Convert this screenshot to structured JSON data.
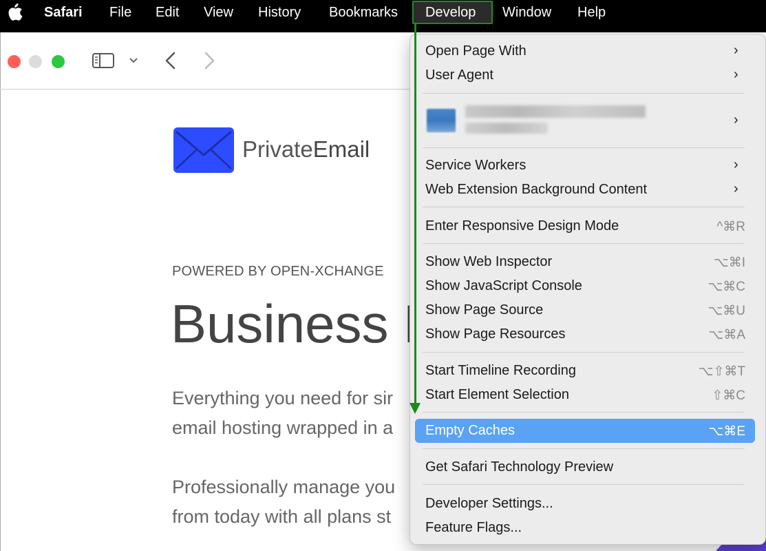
{
  "menubar": {
    "app": "Safari",
    "items": [
      "File",
      "Edit",
      "View",
      "History",
      "Bookmarks",
      "Develop",
      "Window",
      "Help"
    ]
  },
  "page": {
    "brand_light": "Private",
    "brand_bold": "Email",
    "powered_by": "POWERED BY OPEN-XCHANGE",
    "headline": "Business E",
    "para1_line1": "Everything you need for sir",
    "para1_line2": "email hosting wrapped in a",
    "para2_line1": "Professionally manage you",
    "para2_line2": "from today with all plans st"
  },
  "develop_menu": {
    "open_page_with": "Open Page With",
    "user_agent": "User Agent",
    "service_workers": "Service Workers",
    "web_extension": "Web Extension Background Content",
    "responsive_mode": "Enter Responsive Design Mode",
    "responsive_shortcut": "^⌘R",
    "web_inspector": "Show Web Inspector",
    "web_inspector_shortcut": "⌥⌘I",
    "js_console": "Show JavaScript Console",
    "js_console_shortcut": "⌥⌘C",
    "page_source": "Show Page Source",
    "page_source_shortcut": "⌥⌘U",
    "page_resources": "Show Page Resources",
    "page_resources_shortcut": "⌥⌘A",
    "timeline": "Start Timeline Recording",
    "timeline_shortcut": "⌥⇧⌘T",
    "element_selection": "Start Element Selection",
    "element_selection_shortcut": "⇧⌘C",
    "empty_caches": "Empty Caches",
    "empty_caches_shortcut": "⌥⌘E",
    "tech_preview": "Get Safari Technology Preview",
    "developer_settings": "Developer Settings...",
    "feature_flags": "Feature Flags..."
  },
  "colors": {
    "highlight": "#5aa2f3",
    "annotation": "#1a8a1a",
    "brand_blue": "#2d4bff"
  }
}
